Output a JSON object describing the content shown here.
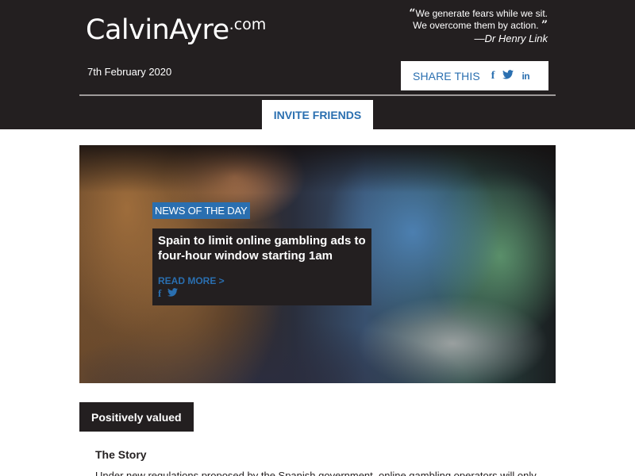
{
  "header": {
    "logo": {
      "main": "CalvinAyre",
      "suffix": ".com"
    },
    "quote": {
      "line1": "We generate fears while we sit.",
      "line2": "We overcome them by action.",
      "author": "—Dr Henry Link",
      "open_mark": "“",
      "close_mark": "”"
    },
    "date": "7th February 2020",
    "share": {
      "label": "SHARE THIS",
      "icons": [
        "facebook-icon",
        "twitter-icon",
        "linkedin-icon"
      ],
      "fb_glyph": "f",
      "tw_glyph": "t",
      "in_glyph": "in"
    },
    "invite_label": "INVITE FRIENDS"
  },
  "hero": {
    "tag": "NEWS OF THE DAY",
    "title": "Spain to limit online gambling ads to four-hour window starting 1am",
    "read_more": "READ MORE >",
    "icons": [
      "facebook-icon",
      "twitter-icon"
    ]
  },
  "section": {
    "tab_label": "Positively valued",
    "story_title": "The Story",
    "story_body": "Under new regulations proposed by the Spanish government, online gambling operators will only"
  },
  "colors": {
    "dark": "#231f20",
    "accent": "#2a6fb0",
    "white": "#ffffff",
    "divider": "#9e9a9a"
  }
}
